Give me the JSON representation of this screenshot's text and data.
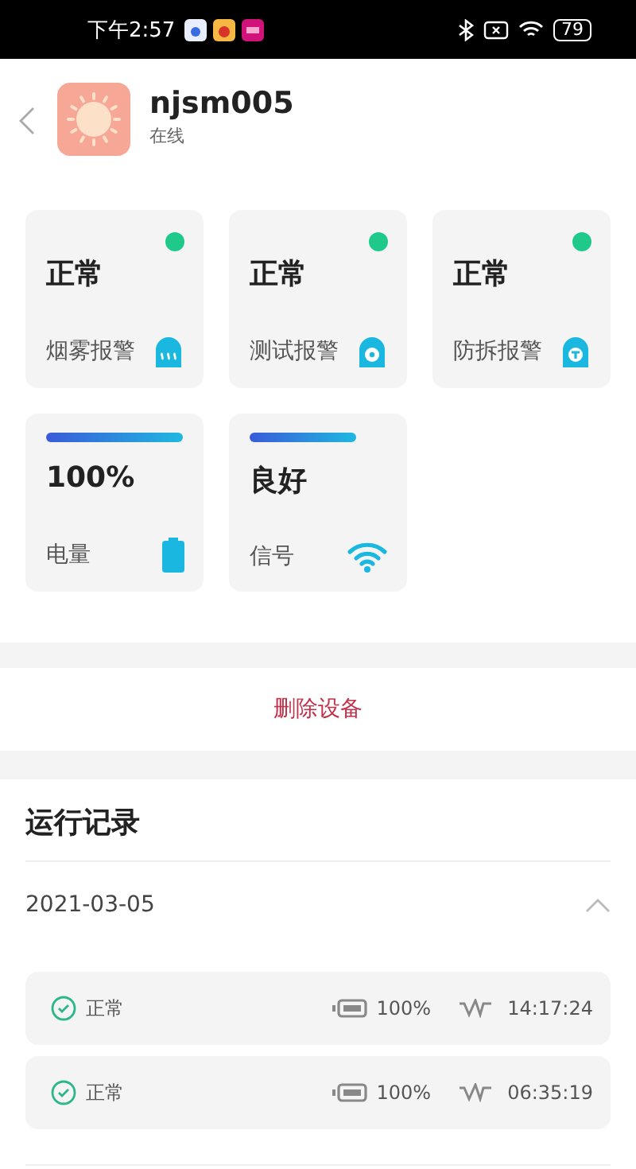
{
  "status_bar": {
    "time": "下午2:57",
    "battery": "79"
  },
  "device": {
    "name": "njsm005",
    "status": "在线"
  },
  "cards": [
    {
      "kind": "alarm",
      "value": "正常",
      "label": "烟雾报警",
      "color": "#1ec98a"
    },
    {
      "kind": "alarm",
      "value": "正常",
      "label": "测试报警",
      "color": "#1ec98a"
    },
    {
      "kind": "alarm",
      "value": "正常",
      "label": "防拆报警",
      "color": "#1ec98a"
    },
    {
      "kind": "meter",
      "value": "100%",
      "label": "电量"
    },
    {
      "kind": "meter",
      "value": "良好",
      "label": "信号"
    }
  ],
  "delete_button": "删除设备",
  "log": {
    "title": "运行记录",
    "date": "2021-03-05",
    "expanded": true,
    "records": [
      {
        "status": "正常",
        "battery": "100%",
        "time": "14:17:24"
      },
      {
        "status": "正常",
        "battery": "100%",
        "time": "06:35:19"
      }
    ]
  }
}
